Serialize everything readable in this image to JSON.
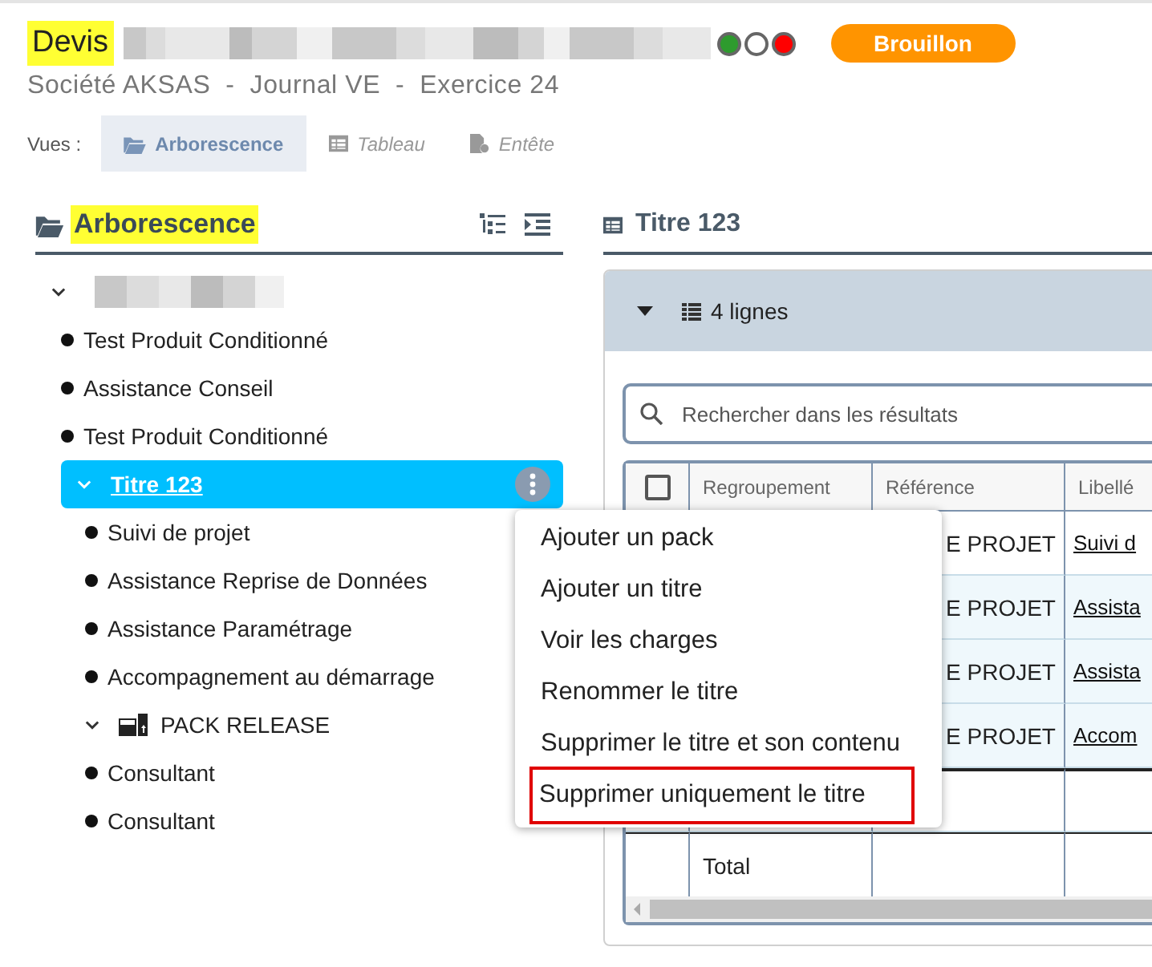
{
  "header": {
    "title": "Devis",
    "title_redacted": true,
    "status_dots": [
      {
        "color": "#2e9b2e"
      },
      {
        "color": "#ffffff"
      },
      {
        "color": "#ff0000"
      }
    ],
    "badge": "Brouillon",
    "subtitle": "Société AKSAS  -  Journal VE  -  Exercice 24"
  },
  "views": {
    "label": "Vues :",
    "tabs": [
      {
        "label": "Arborescence",
        "selected": true
      },
      {
        "label": "Tableau",
        "selected": false
      },
      {
        "label": "Entête",
        "selected": false
      }
    ]
  },
  "tree": {
    "title": "Arborescence",
    "nodes": [
      {
        "kind": "redacted",
        "expanded": true,
        "selected": false,
        "children": [
          {
            "kind": "item",
            "label": "Test Produit Conditionné",
            "selected": false
          },
          {
            "kind": "item",
            "label": "Assistance Conseil",
            "selected": false
          },
          {
            "kind": "item",
            "label": "Test Produit Conditionné",
            "selected": false
          },
          {
            "kind": "title",
            "label": "Titre 123",
            "expanded": true,
            "selected": true,
            "children": [
              {
                "kind": "item",
                "label": "Suivi de projet",
                "selected": false
              },
              {
                "kind": "item",
                "label": "Assistance Reprise de Données",
                "selected": false
              },
              {
                "kind": "item",
                "label": "Assistance Paramétrage",
                "selected": false
              },
              {
                "kind": "item",
                "label": "Accompagnement au démarrage",
                "selected": false
              },
              {
                "kind": "pack",
                "label": "PACK RELEASE",
                "expanded": true,
                "selected": false,
                "children": [
                  {
                    "kind": "item",
                    "label": "Consultant",
                    "selected": false
                  },
                  {
                    "kind": "item",
                    "label": "Consultant",
                    "selected": false
                  }
                ]
              }
            ]
          }
        ]
      }
    ]
  },
  "panel": {
    "title": "Titre 123",
    "summary": "4 lignes",
    "search": {
      "placeholder": "Rechercher dans les résultats"
    },
    "table": {
      "select_all_checked": false,
      "columns": [
        "Regroupement",
        "Référence",
        "Libellé"
      ],
      "rows": [
        {
          "shaded": false,
          "reference": "E PROJET",
          "libelle": "Suivi d"
        },
        {
          "shaded": true,
          "reference": "E PROJET",
          "libelle": "Assista"
        },
        {
          "shaded": true,
          "reference": "E PROJET",
          "libelle": "Assista"
        },
        {
          "shaded": true,
          "reference": "E PROJET",
          "libelle": "Accom"
        }
      ],
      "total_label": "Total"
    }
  },
  "context_menu": {
    "items": [
      {
        "label": "Ajouter un pack",
        "highlighted": false
      },
      {
        "label": "Ajouter un titre",
        "highlighted": false
      },
      {
        "label": "Voir les charges",
        "highlighted": false
      },
      {
        "label": "Renommer le titre",
        "highlighted": false
      },
      {
        "label": "Supprimer le titre et son contenu",
        "highlighted": false
      },
      {
        "label": "Supprimer uniquement le titre",
        "highlighted": true
      }
    ]
  }
}
